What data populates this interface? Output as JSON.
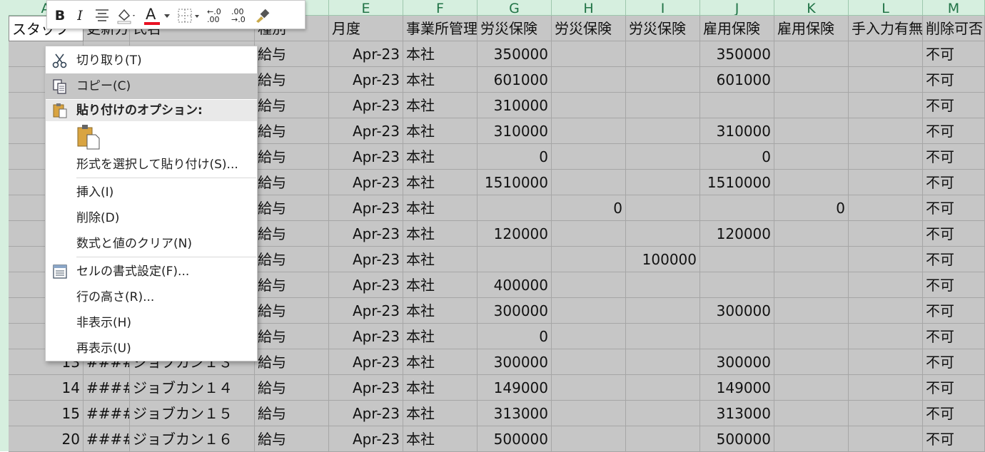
{
  "sheet": {
    "columns": [
      {
        "letter": "A",
        "header": "スタッフ"
      },
      {
        "letter": "",
        "header": "更新方"
      },
      {
        "letter": "",
        "header": "氏名"
      },
      {
        "letter": "",
        "header": "種別"
      },
      {
        "letter": "E",
        "header": "月度"
      },
      {
        "letter": "F",
        "header": "事業所管理"
      },
      {
        "letter": "G",
        "header": "労災保険"
      },
      {
        "letter": "H",
        "header": "労災保険"
      },
      {
        "letter": "I",
        "header": "労災保険"
      },
      {
        "letter": "J",
        "header": "雇用保険"
      },
      {
        "letter": "K",
        "header": "雇用保険"
      },
      {
        "letter": "L",
        "header": "手入力有無"
      },
      {
        "letter": "M",
        "header": "削除可否"
      }
    ],
    "rows": [
      {
        "a": "",
        "b": "",
        "c": "",
        "d": "給与",
        "e": "Apr-23",
        "f": "本社",
        "g": "350000",
        "h": "",
        "i": "",
        "j": "350000",
        "k": "",
        "l": "",
        "m": "不可"
      },
      {
        "a": "",
        "b": "",
        "c": "",
        "d": "給与",
        "e": "Apr-23",
        "f": "本社",
        "g": "601000",
        "h": "",
        "i": "",
        "j": "601000",
        "k": "",
        "l": "",
        "m": "不可"
      },
      {
        "a": "",
        "b": "",
        "c": "",
        "d": "給与",
        "e": "Apr-23",
        "f": "本社",
        "g": "310000",
        "h": "",
        "i": "",
        "j": "",
        "k": "",
        "l": "",
        "m": "不可"
      },
      {
        "a": "",
        "b": "",
        "c": "",
        "d": "給与",
        "e": "Apr-23",
        "f": "本社",
        "g": "310000",
        "h": "",
        "i": "",
        "j": "310000",
        "k": "",
        "l": "",
        "m": "不可"
      },
      {
        "a": "",
        "b": "",
        "c": "",
        "d": "給与",
        "e": "Apr-23",
        "f": "本社",
        "g": "0",
        "h": "",
        "i": "",
        "j": "0",
        "k": "",
        "l": "",
        "m": "不可"
      },
      {
        "a": "",
        "b": "",
        "c": "",
        "d": "給与",
        "e": "Apr-23",
        "f": "本社",
        "g": "1510000",
        "h": "",
        "i": "",
        "j": "1510000",
        "k": "",
        "l": "",
        "m": "不可"
      },
      {
        "a": "",
        "b": "",
        "c": "",
        "d": "給与",
        "e": "Apr-23",
        "f": "本社",
        "g": "",
        "h": "0",
        "i": "",
        "j": "",
        "k": "0",
        "l": "",
        "m": "不可"
      },
      {
        "a": "",
        "b": "",
        "c": "",
        "d": "給与",
        "e": "Apr-23",
        "f": "本社",
        "g": "120000",
        "h": "",
        "i": "",
        "j": "120000",
        "k": "",
        "l": "",
        "m": "不可"
      },
      {
        "a": "",
        "b": "",
        "c": "",
        "d": "給与",
        "e": "Apr-23",
        "f": "本社",
        "g": "",
        "h": "",
        "i": "100000",
        "j": "",
        "k": "",
        "l": "",
        "m": "不可"
      },
      {
        "a": "",
        "b": "",
        "c": "",
        "d": "給与",
        "e": "Apr-23",
        "f": "本社",
        "g": "400000",
        "h": "",
        "i": "",
        "j": "",
        "k": "",
        "l": "",
        "m": "不可"
      },
      {
        "a": "",
        "b": "",
        "c": "",
        "d": "給与",
        "e": "Apr-23",
        "f": "本社",
        "g": "300000",
        "h": "",
        "i": "",
        "j": "300000",
        "k": "",
        "l": "",
        "m": "不可"
      },
      {
        "a": "",
        "b": "",
        "c": "",
        "d": "給与",
        "e": "Apr-23",
        "f": "本社",
        "g": "0",
        "h": "",
        "i": "",
        "j": "",
        "k": "",
        "l": "",
        "m": "不可"
      },
      {
        "a": "13",
        "b": "####",
        "c": "ジョブカン１３",
        "d": "給与",
        "e": "Apr-23",
        "f": "本社",
        "g": "300000",
        "h": "",
        "i": "",
        "j": "300000",
        "k": "",
        "l": "",
        "m": "不可"
      },
      {
        "a": "14",
        "b": "####",
        "c": "ジョブカン１４",
        "d": "給与",
        "e": "Apr-23",
        "f": "本社",
        "g": "149000",
        "h": "",
        "i": "",
        "j": "149000",
        "k": "",
        "l": "",
        "m": "不可"
      },
      {
        "a": "15",
        "b": "####",
        "c": "ジョブカン１５",
        "d": "給与",
        "e": "Apr-23",
        "f": "本社",
        "g": "313000",
        "h": "",
        "i": "",
        "j": "313000",
        "k": "",
        "l": "",
        "m": "不可"
      },
      {
        "a": "20",
        "b": "####",
        "c": "ジョブカン１６",
        "d": "給与",
        "e": "Apr-23",
        "f": "本社",
        "g": "500000",
        "h": "",
        "i": "",
        "j": "500000",
        "k": "",
        "l": "",
        "m": "不可"
      }
    ]
  },
  "minibar": {
    "bold": "B",
    "italic": "I",
    "font_color_glyph": "A",
    "increase_decimal": "←.0\n.00",
    "decrease_decimal": ".00\n→.0",
    "font_color": "#e81123"
  },
  "menu": {
    "cut": "切り取り(T)",
    "copy": "コピー(C)",
    "paste_options": "貼り付けのオプション:",
    "paste_special": "形式を選択して貼り付け(S)...",
    "insert": "挿入(I)",
    "delete": "削除(D)",
    "clear": "数式と値のクリア(N)",
    "format_cells": "セルの書式設定(F)...",
    "row_height": "行の高さ(R)...",
    "hide": "非表示(H)",
    "unhide": "再表示(U)"
  },
  "colors": {
    "selection": "#c6c6c6",
    "header_bg": "#d6efdf",
    "header_text": "#217346"
  }
}
